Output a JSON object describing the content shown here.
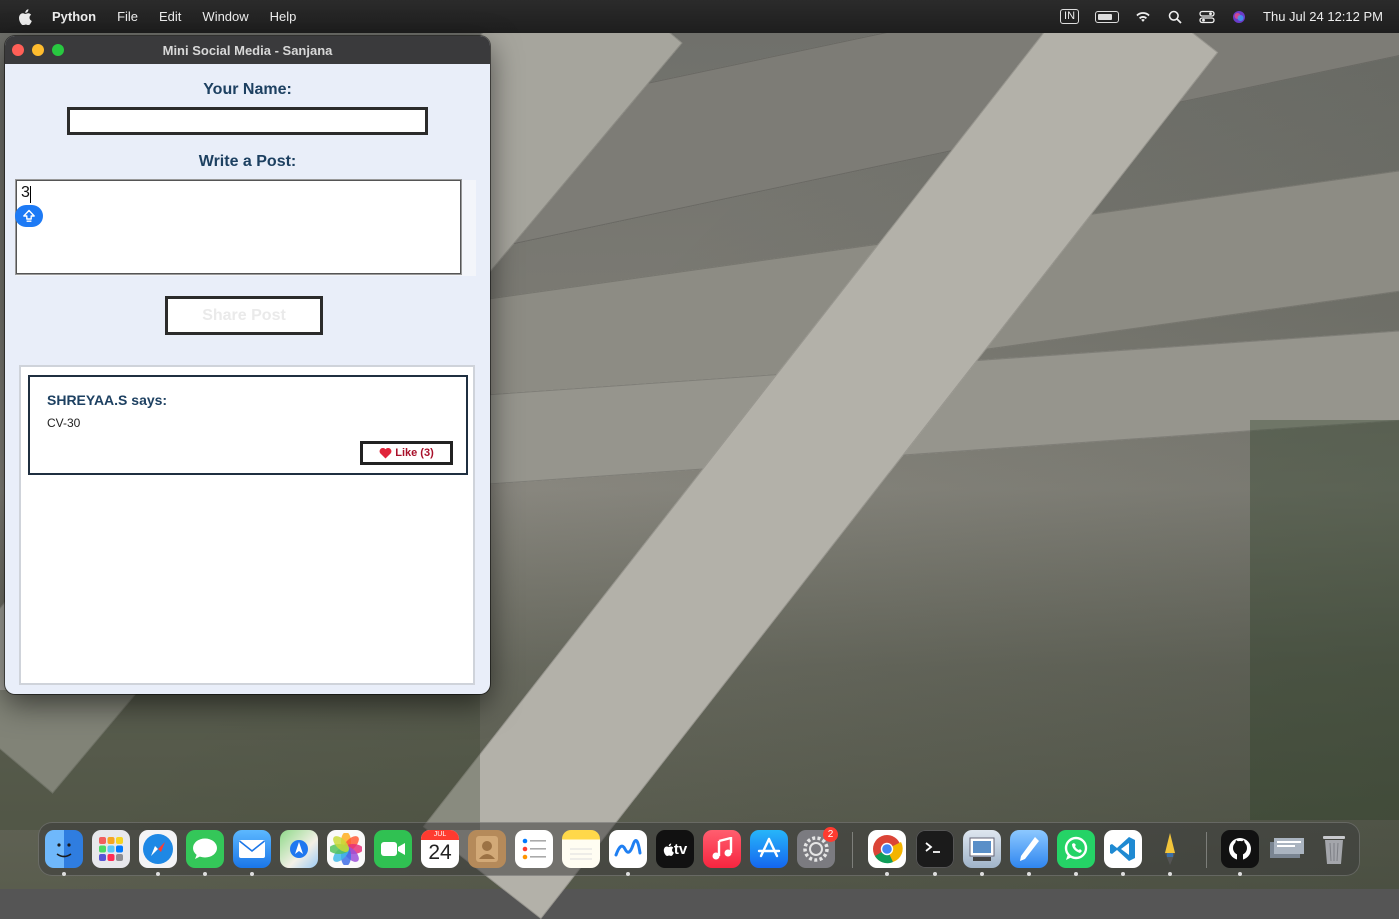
{
  "menubar": {
    "app_name": "Python",
    "items": [
      "File",
      "Edit",
      "Window",
      "Help"
    ],
    "input_source": "IN",
    "clock": "Thu Jul 24  12:12 PM"
  },
  "window": {
    "title": "Mini Social Media - Sanjana",
    "name_label": "Your Name:",
    "name_value": "",
    "post_label": "Write a Post:",
    "post_value": "3",
    "share_button": "Share Post"
  },
  "feed": {
    "posts": [
      {
        "author_line": "SHREYAA.S says:",
        "content": "CV-30",
        "like_label": "Like (3)",
        "like_count": 3
      }
    ]
  },
  "dock": {
    "apps": [
      {
        "name": "finder-icon",
        "color": "#3a8ef6"
      },
      {
        "name": "launchpad-icon",
        "color": "#e8e8ec"
      },
      {
        "name": "safari-icon",
        "color": "#1e88e5"
      },
      {
        "name": "messages-icon",
        "color": "#34c759"
      },
      {
        "name": "mail-icon",
        "color": "#3b9cf5"
      },
      {
        "name": "maps-icon",
        "color": "#5cc16a"
      },
      {
        "name": "photos-icon",
        "color": "#f4f4f4"
      },
      {
        "name": "facetime-icon",
        "color": "#30c152"
      },
      {
        "name": "calendar-icon",
        "color": "#ffffff"
      },
      {
        "name": "contacts-icon",
        "color": "#b58a5a"
      },
      {
        "name": "reminders-icon",
        "color": "#ffffff"
      },
      {
        "name": "notes-icon",
        "color": "#ffd84a"
      },
      {
        "name": "freeform-icon",
        "color": "#ffffff"
      },
      {
        "name": "apple-tv-icon",
        "color": "#111111"
      },
      {
        "name": "music-icon",
        "color": "#fa3f53"
      },
      {
        "name": "app-store-icon",
        "color": "#1a8cf7"
      },
      {
        "name": "system-settings-icon",
        "color": "#7b7b80"
      },
      {
        "name": "chrome-icon",
        "color": "#ffffff"
      },
      {
        "name": "terminal-icon",
        "color": "#1b1b1b"
      },
      {
        "name": "preview-icon",
        "color": "#b9c9d9"
      },
      {
        "name": "textedit-pen-icon",
        "color": "#4aa3f0"
      },
      {
        "name": "whatsapp-icon",
        "color": "#25d366"
      },
      {
        "name": "vscode-icon",
        "color": "#ffffff"
      },
      {
        "name": "python-launcher-icon",
        "color": "#444444"
      },
      {
        "name": "github-desktop-icon",
        "color": "#111111"
      },
      {
        "name": "downloads-stack-icon",
        "color": "#6d7a88"
      },
      {
        "name": "trash-icon",
        "color": "#8f9096"
      }
    ],
    "calendar_month": "JUL",
    "calendar_day": "24",
    "settings_badge": "2",
    "apple_tv_label": "tv"
  }
}
